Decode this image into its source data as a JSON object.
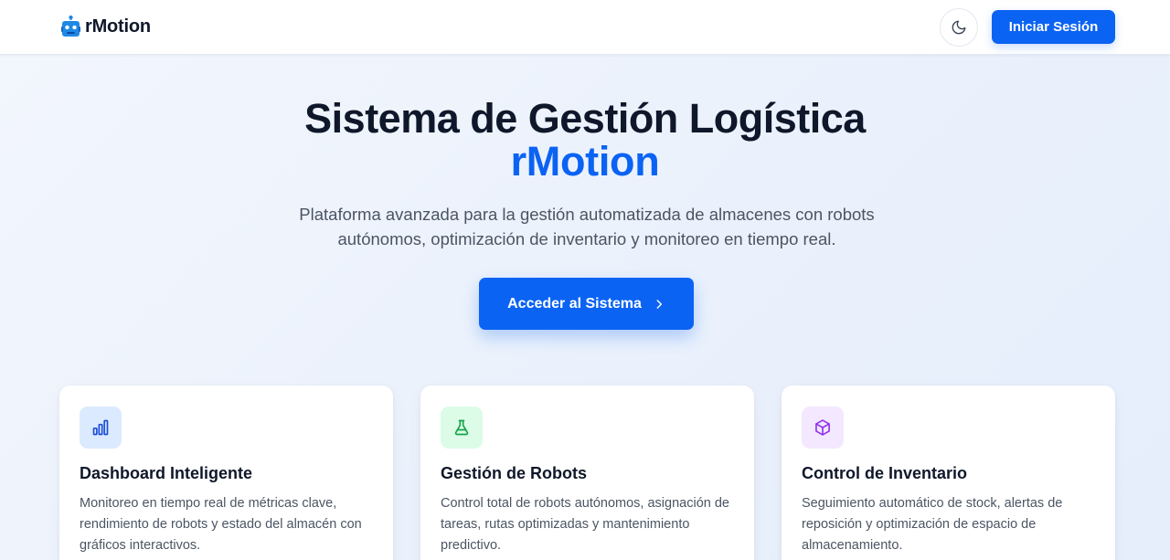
{
  "header": {
    "brand": "rMotion",
    "brand_icon": "robot-icon",
    "theme_toggle_icon": "moon-icon",
    "login_label": "Iniciar Sesión"
  },
  "hero": {
    "title": "Sistema de Gestión Logística",
    "brand": "rMotion",
    "subtitle": "Plataforma avanzada para la gestión automatizada de almacenes con robots autónomos, optimización de inventario y monitoreo en tiempo real.",
    "cta_label": "Acceder al Sistema",
    "cta_icon": "chevron-right-icon"
  },
  "features": [
    {
      "icon": "bar-chart-icon",
      "title": "Dashboard Inteligente",
      "description": "Monitoreo en tiempo real de métricas clave, rendimiento de robots y estado del almacén con gráficos interactivos."
    },
    {
      "icon": "flask-icon",
      "title": "Gestión de Robots",
      "description": "Control total de robots autónomos, asignación de tareas, rutas optimizadas y mantenimiento predictivo."
    },
    {
      "icon": "box-icon",
      "title": "Control de Inventario",
      "description": "Seguimiento automático de stock, alertas de reposición y optimización de espacio de almacenamiento."
    }
  ],
  "colors": {
    "accent": "#0b63f3",
    "text_dark": "#0f172a",
    "text_muted": "#4b5563",
    "icon_blue_bg": "#dbeafe",
    "icon_green_bg": "#dcfce7",
    "icon_purple_bg": "#f3e8ff"
  }
}
